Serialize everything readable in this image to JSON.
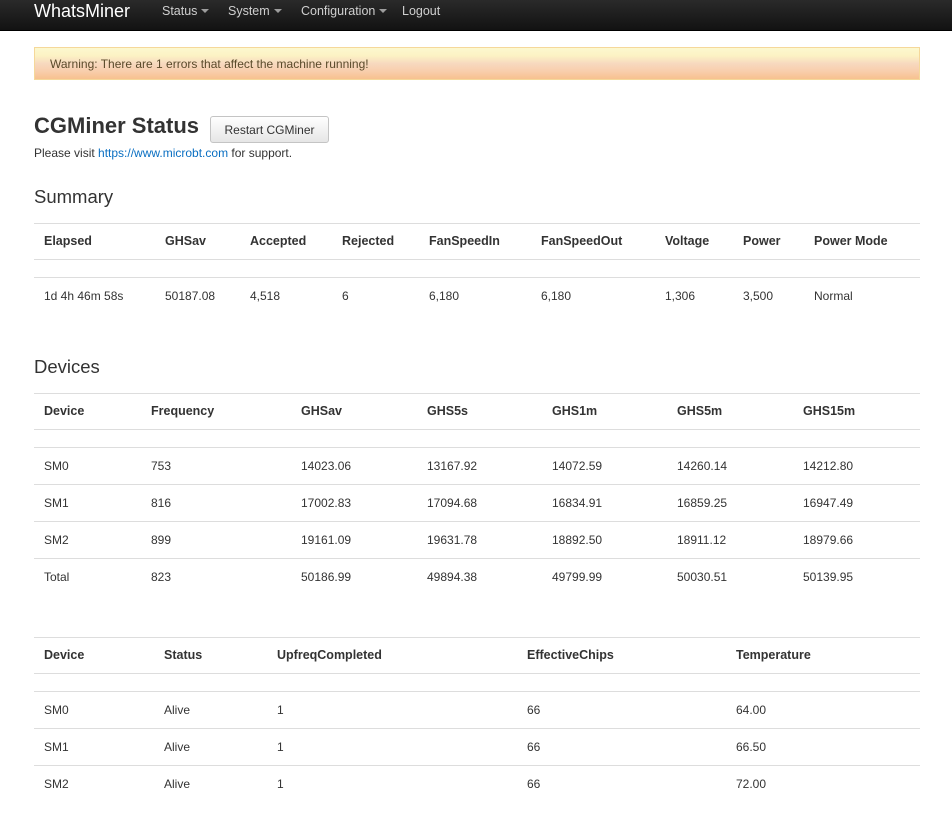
{
  "navbar": {
    "brand": "WhatsMiner",
    "menu": [
      {
        "label": "Status",
        "dropdown": true
      },
      {
        "label": "System",
        "dropdown": true
      },
      {
        "label": "Configuration",
        "dropdown": true
      },
      {
        "label": "Logout",
        "dropdown": false
      }
    ]
  },
  "alert": {
    "text": "Warning: There are 1 errors that affect the machine running!"
  },
  "page": {
    "title": "CGMiner Status",
    "restart_label": "Restart CGMiner",
    "support_prefix": "Please visit ",
    "support_link": "https://www.microbt.com",
    "support_suffix": " for support."
  },
  "summary": {
    "title": "Summary",
    "headers": [
      "Elapsed",
      "GHSav",
      "Accepted",
      "Rejected",
      "FanSpeedIn",
      "FanSpeedOut",
      "Voltage",
      "Power",
      "Power Mode"
    ],
    "row": [
      "1d 4h 46m 58s",
      "50187.08",
      "4,518",
      "6",
      "6,180",
      "6,180",
      "1,306",
      "3,500",
      "Normal"
    ]
  },
  "devices": {
    "title": "Devices",
    "headers": [
      "Device",
      "Frequency",
      "GHSav",
      "GHS5s",
      "GHS1m",
      "GHS5m",
      "GHS15m"
    ],
    "rows": [
      [
        "SM0",
        "753",
        "14023.06",
        "13167.92",
        "14072.59",
        "14260.14",
        "14212.80"
      ],
      [
        "SM1",
        "816",
        "17002.83",
        "17094.68",
        "16834.91",
        "16859.25",
        "16947.49"
      ],
      [
        "SM2",
        "899",
        "19161.09",
        "19631.78",
        "18892.50",
        "18911.12",
        "18979.66"
      ],
      [
        "Total",
        "823",
        "50186.99",
        "49894.38",
        "49799.99",
        "50030.51",
        "50139.95"
      ]
    ]
  },
  "device_status": {
    "headers": [
      "Device",
      "Status",
      "UpfreqCompleted",
      "EffectiveChips",
      "Temperature"
    ],
    "rows": [
      [
        "SM0",
        "Alive",
        "1",
        "66",
        "64.00"
      ],
      [
        "SM1",
        "Alive",
        "1",
        "66",
        "66.50"
      ],
      [
        "SM2",
        "Alive",
        "1",
        "66",
        "72.00"
      ]
    ]
  }
}
